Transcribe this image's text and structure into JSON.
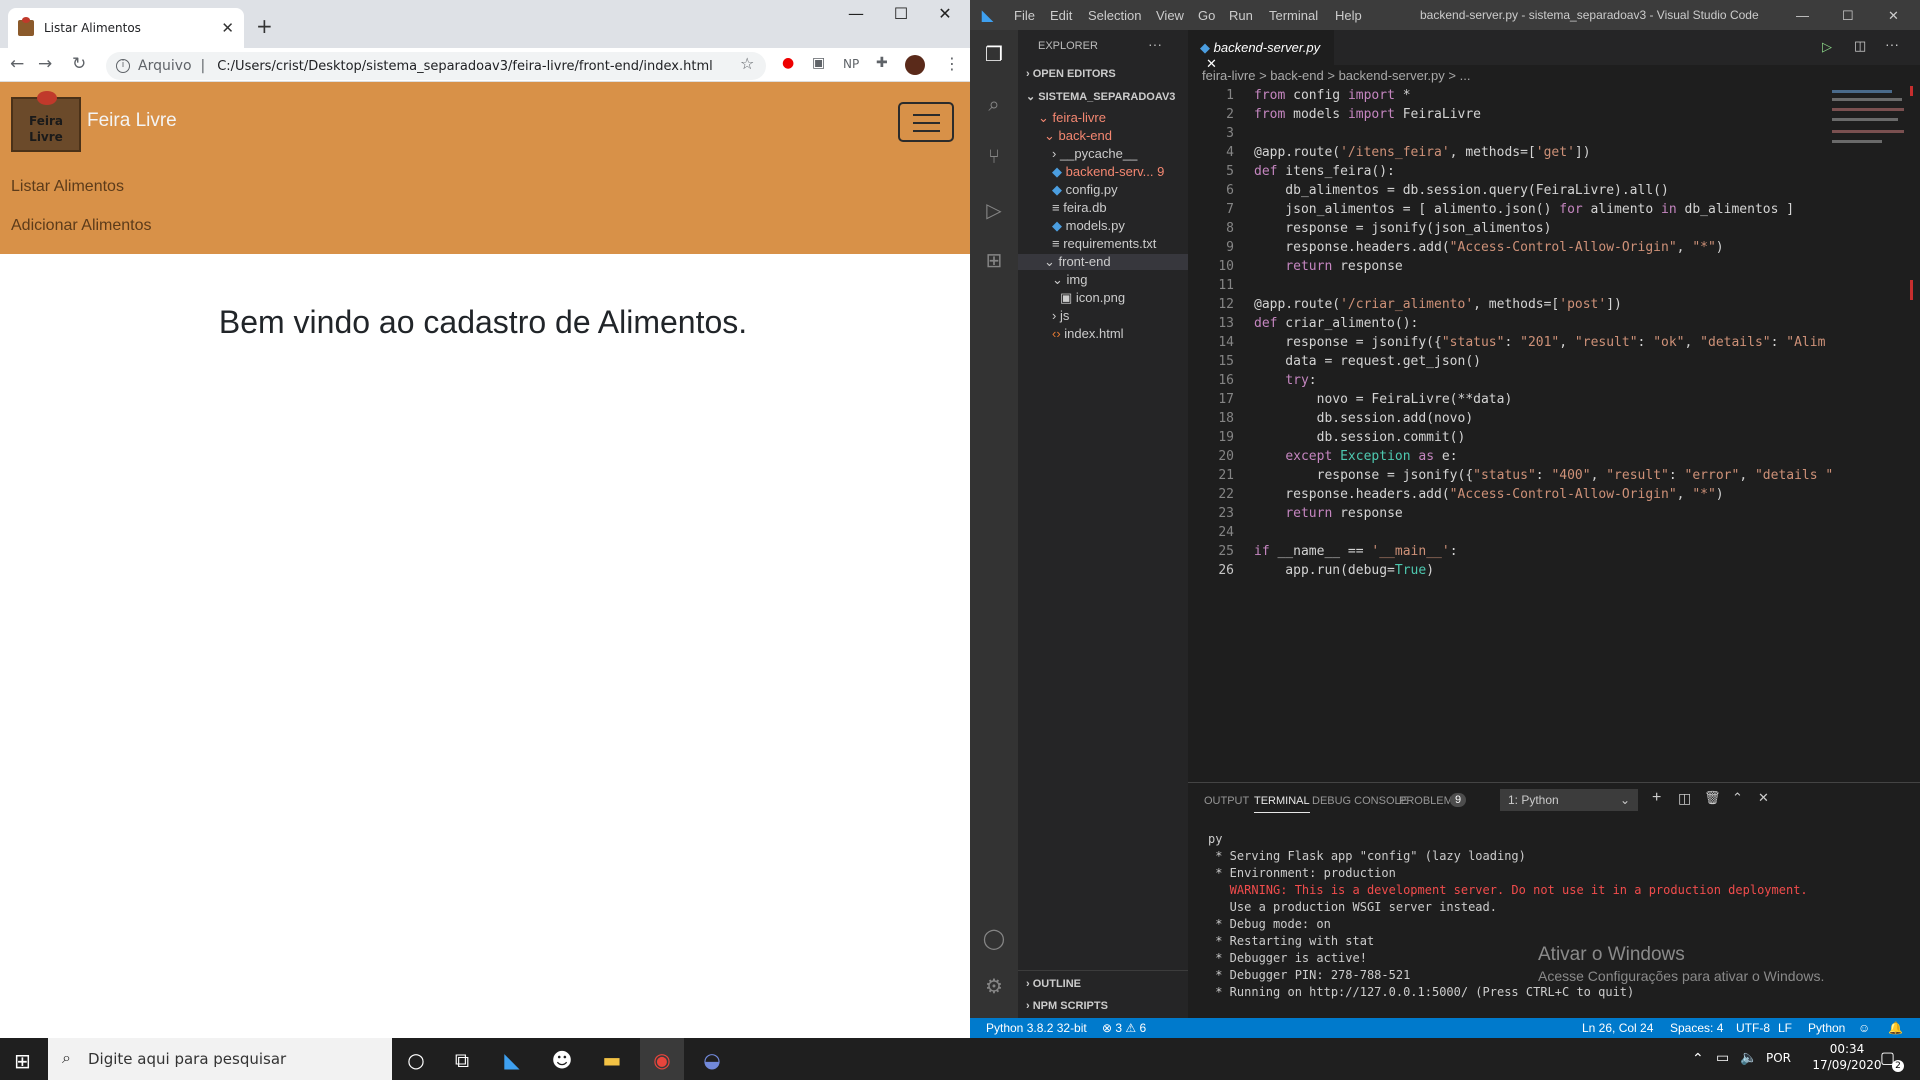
{
  "browser": {
    "tab_title": "Listar Alimentos",
    "tab_close": "✕",
    "new_tab": "+",
    "address_prefix": "Arquivo",
    "url": "C:/Users/crist/Desktop/sistema_separadoav3/feira-livre/front-end/index.html",
    "ext_np": "NP"
  },
  "page": {
    "logo_text": "Feira Livre",
    "brand": "Feira Livre",
    "nav": [
      "Listar Alimentos",
      "Adicionar Alimentos"
    ],
    "welcome": "Bem vindo ao cadastro de Alimentos."
  },
  "vscode": {
    "menu": [
      "File",
      "Edit",
      "Selection",
      "View",
      "Go",
      "Run",
      "Terminal",
      "Help"
    ],
    "window_title": "backend-server.py - sistema_separadoav3 - Visual Studio Code",
    "explorer_label": "EXPLORER",
    "open_editors": "OPEN EDITORS",
    "workspace": "SISTEMA_SEPARADOAV3",
    "tree": [
      {
        "label": "feira-livre",
        "color": "#f48771"
      },
      {
        "label": "back-end",
        "color": "#f48771"
      },
      {
        "label": "__pycache__",
        "color": "#cccccc"
      },
      {
        "label": "backend-serv...",
        "color": "#f48771",
        "badge": "9"
      },
      {
        "label": "config.py",
        "color": "#cccccc"
      },
      {
        "label": "feira.db",
        "color": "#cccccc"
      },
      {
        "label": "models.py",
        "color": "#cccccc"
      },
      {
        "label": "requirements.txt",
        "color": "#cccccc"
      },
      {
        "label": "front-end",
        "color": "#cccccc"
      },
      {
        "label": "img",
        "color": "#cccccc"
      },
      {
        "label": "icon.png",
        "color": "#cccccc"
      },
      {
        "label": "js",
        "color": "#cccccc"
      },
      {
        "label": "index.html",
        "color": "#cccccc"
      }
    ],
    "outline": "OUTLINE",
    "npm_scripts": "NPM SCRIPTS",
    "editor_tab": "backend-server.py",
    "breadcrumbs": "feira-livre > back-end > backend-server.py > ...",
    "code_lines": [
      "from config import *",
      "from models import FeiraLivre",
      "",
      "@app.route('/itens_feira', methods=['get'])",
      "def itens_feira():",
      "    db_alimentos = db.session.query(FeiraLivre).all()",
      "    json_alimentos = [ alimento.json() for alimento in db_alimentos ]",
      "    response = jsonify(json_alimentos)",
      "    response.headers.add(\"Access-Control-Allow-Origin\", \"*\")",
      "    return response",
      "",
      "@app.route('/criar_alimento', methods=['post'])",
      "def criar_alimento():",
      "    response = jsonify({\"status\": \"201\", \"result\": \"ok\", \"details\": \"Alim",
      "    data = request.get_json()",
      "    try:",
      "        novo = FeiraLivre(**data)",
      "        db.session.add(novo)",
      "        db.session.commit()",
      "    except Exception as e:",
      "        response = jsonify({\"status\": \"400\", \"result\": \"error\", \"details \"",
      "    response.headers.add(\"Access-Control-Allow-Origin\", \"*\")",
      "    return response",
      "",
      "if __name__ == '__main__':",
      "    app.run(debug=True)"
    ],
    "panel_tabs": [
      "OUTPUT",
      "TERMINAL",
      "DEBUG CONSOLE",
      "PROBLEMS"
    ],
    "problems_count": "9",
    "terminal_select": "1: Python",
    "terminal_lines": [
      {
        "text": "py",
        "color": "#cccccc"
      },
      {
        "text": " * Serving Flask app \"config\" (lazy loading)",
        "color": "#cccccc"
      },
      {
        "text": " * Environment: production",
        "color": "#cccccc"
      },
      {
        "text": "   WARNING: This is a development server. Do not use it in a production deployment.",
        "color": "#f14c4c"
      },
      {
        "text": "   Use a production WSGI server instead.",
        "color": "#cccccc"
      },
      {
        "text": " * Debug mode: on",
        "color": "#cccccc"
      },
      {
        "text": " * Restarting with stat",
        "color": "#cccccc"
      },
      {
        "text": " * Debugger is active!",
        "color": "#cccccc"
      },
      {
        "text": " * Debugger PIN: 278-788-521",
        "color": "#cccccc"
      },
      {
        "text": " * Running on http://127.0.0.1:5000/ (Press CTRL+C to quit)",
        "color": "#cccccc"
      }
    ],
    "status": {
      "python": "Python 3.8.2 32-bit",
      "errors": "⊗ 3 ⚠ 6",
      "position": "Ln 26, Col 24",
      "spaces": "Spaces: 4",
      "encoding": "UTF-8",
      "eol": "LF",
      "language": "Python"
    }
  },
  "watermark": {
    "title": "Ativar o Windows",
    "subtitle": "Acesse Configurações para ativar o Windows."
  },
  "taskbar": {
    "search_placeholder": "Digite aqui para pesquisar",
    "lang": "POR",
    "time": "00:34",
    "date": "17/09/2020",
    "notif_count": "2"
  }
}
